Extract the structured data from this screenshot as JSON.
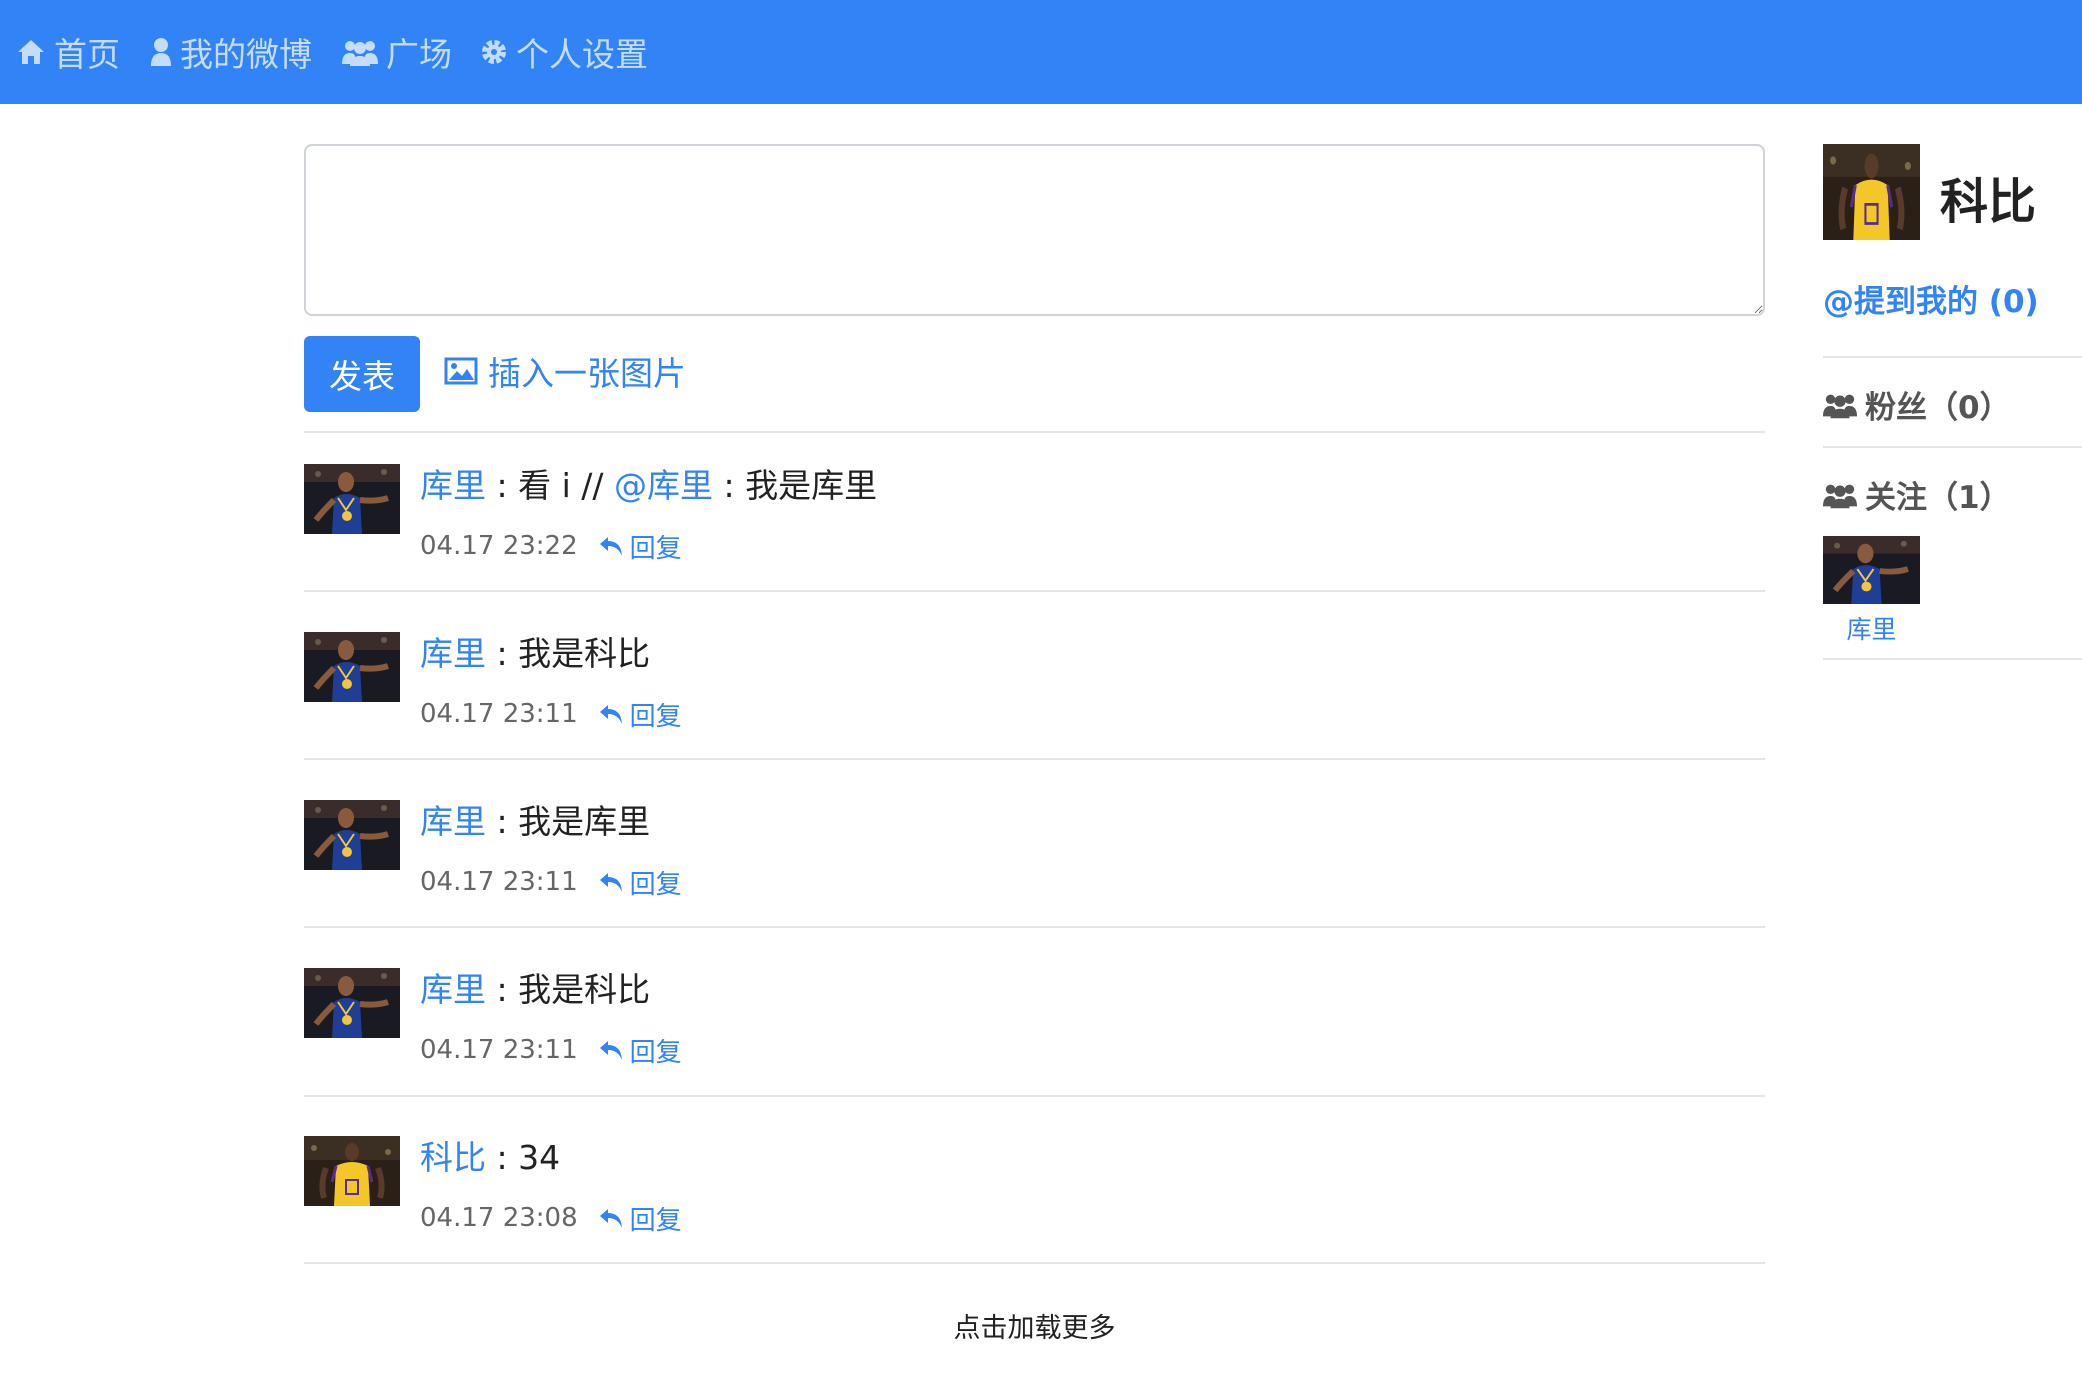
{
  "colors": {
    "accent": "#3283f6",
    "navbar": "#3283f6",
    "divider": "#e3e6e9",
    "meta_text": "#666666"
  },
  "nav": [
    {
      "icon": "home-icon",
      "label": "首页"
    },
    {
      "icon": "user-icon",
      "label": "我的微博"
    },
    {
      "icon": "users-icon",
      "label": "广场"
    },
    {
      "icon": "gear-icon",
      "label": "个人设置"
    }
  ],
  "composer": {
    "value": "",
    "post_label": "发表",
    "insert_image_label": "插入一张图片",
    "insert_image_icon": "image-icon"
  },
  "feed": [
    {
      "avatar": "curry",
      "author": "库里",
      "sep": " : ",
      "text": "看 i // ",
      "mention": "@库里",
      "mention_sep": " : ",
      "mention_text": "我是库里",
      "time": "04.17 23:22",
      "reply_label": "回复"
    },
    {
      "avatar": "curry",
      "author": "库里",
      "sep": " : ",
      "text": "我是科比",
      "time": "04.17 23:11",
      "reply_label": "回复"
    },
    {
      "avatar": "curry",
      "author": "库里",
      "sep": " : ",
      "text": "我是库里",
      "time": "04.17 23:11",
      "reply_label": "回复"
    },
    {
      "avatar": "curry",
      "author": "库里",
      "sep": " : ",
      "text": "我是科比",
      "time": "04.17 23:11",
      "reply_label": "回复"
    },
    {
      "avatar": "kobe",
      "author": "科比",
      "sep": " : ",
      "text": "34",
      "time": "04.17 23:08",
      "reply_label": "回复"
    }
  ],
  "load_more": "点击加载更多",
  "profile": {
    "avatar": "kobe",
    "name": "科比",
    "mentions": "@提到我的 (0)",
    "fans": "粉丝（0）",
    "following": "关注（1）",
    "following_list": [
      {
        "avatar": "curry",
        "name": "库里"
      }
    ]
  }
}
